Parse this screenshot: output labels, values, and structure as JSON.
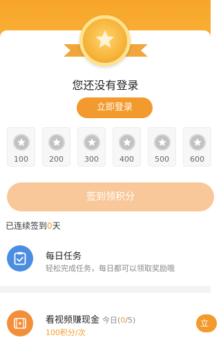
{
  "header": {
    "login_status": "您还没有登录",
    "login_button": "立即登录"
  },
  "rewards": [
    {
      "value": "100"
    },
    {
      "value": "200"
    },
    {
      "value": "300"
    },
    {
      "value": "400"
    },
    {
      "value": "500"
    },
    {
      "value": "600"
    }
  ],
  "signin": {
    "button": "签到领积分",
    "streak_prefix": "已连续签到",
    "streak_days": "0",
    "streak_suffix": "天"
  },
  "tasks": {
    "daily": {
      "title": "每日任务",
      "desc": "轻松完成任务，每日都可以领取奖励哦",
      "icon": "clipboard-check-icon"
    },
    "video": {
      "title": "看视频赚现金",
      "today_prefix": "今日(",
      "today_count": "0",
      "today_suffix": "/5)",
      "points": "100积分/次",
      "button": "立",
      "icon": "film-icon"
    }
  },
  "colors": {
    "accent": "#f39a2e",
    "signin_disabled": "#f9c89a",
    "task_blue": "#4a8de3"
  }
}
